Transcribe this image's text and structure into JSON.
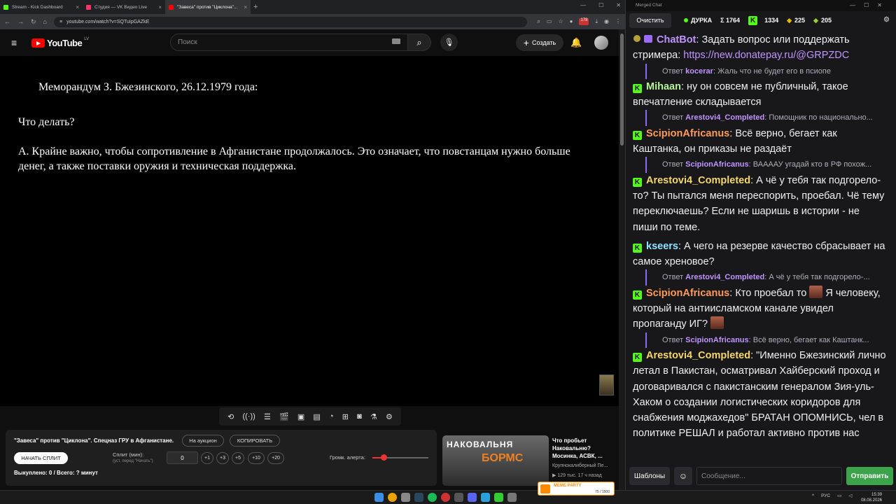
{
  "browser": {
    "tabs": [
      {
        "label": "Stream - Kick Dashboard",
        "color": "#53fc18"
      },
      {
        "label": "Студия — VK Видео Live",
        "color": "#ff3366"
      },
      {
        "label": "\"Завеса\" против \"Циклона\"...",
        "color": "#ff0000"
      }
    ],
    "new_tab": "+",
    "url": "youtube.com/watch?v=SQTuIpGAZkE",
    "ext_badge": "178"
  },
  "youtube": {
    "logo_text": "YouTube",
    "logo_country": "LV",
    "search_placeholder": "Поиск",
    "create_label": "Создать"
  },
  "video": {
    "memo_heading": "Меморандум З. Бжезинского, 26.12.1979 года:",
    "question": "Что делать?",
    "answer": "А. Крайне важно, чтобы сопротивление в Афганистане продолжалось. Это означает, что повстанцам нужно больше денег, а также поставки оружия и техническая поддержка."
  },
  "auction_panel": {
    "title": "\"Завеса\" против \"Циклона\". Спецназ ГРУ в Афганистане.",
    "auction_button": "На аукцион",
    "copy_button": "КОПИРОВАТЬ",
    "start_split_button": "НАЧАТЬ СПЛИТ",
    "split_label": "Сплит (мин):",
    "split_hint": "(уст. перед \"Начать\")",
    "split_value": "0",
    "increments": [
      "+1",
      "+3",
      "+5",
      "+10",
      "+20"
    ],
    "volume_label": "Громк. алерта:",
    "volume_level": 0.2,
    "sold_text": "Выкуплено: 0 / Всего: ? минут"
  },
  "recommendation": {
    "thumb_text_1": "НАКОВАЛЬНЯ",
    "thumb_text_2": "БОРМС",
    "title": "Что пробьет Наковальню? Мосинка, АСВК, ...",
    "channel": "Крупнокалиберный Пе...",
    "meta": "▶ 129 тыс.  17 ч назад"
  },
  "chat": {
    "window_title": "Merged Chat",
    "clear_button": "Очистить",
    "stream_name": "ДУРКА",
    "total": "Σ 1764",
    "kick_count": "1334",
    "other_count_1": "225",
    "other_count_2": "205",
    "messages": [
      {
        "type": "msg",
        "platform": "bot",
        "user": "ChatBot",
        "color": "#bf94ff",
        "text": "Задать вопрос или поддержать стримера: ",
        "link": "https://new.donatepay.ru/@GRPZDC"
      },
      {
        "type": "reply",
        "prefix": "Ответ",
        "user": "kocerar",
        "text": "Жаль что не будет его в псиопе"
      },
      {
        "type": "msg",
        "platform": "kick",
        "user": "Mihaan",
        "color": "#b6f29a",
        "text": "ну он совсем не публичный, такое впечатление складывается"
      },
      {
        "type": "reply",
        "prefix": "Ответ",
        "user": "Arestovi4_Completed",
        "text": "Помощник по национально..."
      },
      {
        "type": "msg",
        "platform": "kick",
        "user": "ScipionAfricanus",
        "color": "#ff9a5a",
        "text": "Всё верно, бегает как Каштанка, он приказы не раздаёт"
      },
      {
        "type": "reply",
        "prefix": "Ответ",
        "user": "ScipionAfricanus",
        "text": "ВААААУ угадай кто в РФ похож..."
      },
      {
        "type": "msg",
        "platform": "kick",
        "user": "Arestovi4_Completed",
        "color": "#f5d76e",
        "text": "А чё у тебя так подгорело-то? Ты пытался меня переспорить, проебал. Чё тему переключаешь? Если не шаришь в истории - не пиши по теме."
      },
      {
        "type": "msg",
        "platform": "kick",
        "user": "kseers",
        "color": "#8fe3ff",
        "text": "А чего на резерве качество сбрасывает на самое хреновое?"
      },
      {
        "type": "reply",
        "prefix": "Ответ",
        "user": "Arestovi4_Completed",
        "text": "А чё у тебя так подгорело-..."
      },
      {
        "type": "msg",
        "platform": "kick",
        "user": "ScipionAfricanus",
        "color": "#ff9a5a",
        "text_parts": [
          "Кто проебал то ",
          " Я человеку, который на антиисламском канале увидел пропаганду ИГ? "
        ]
      },
      {
        "type": "reply",
        "prefix": "Ответ",
        "user": "ScipionAfricanus",
        "text": "Всё верно, бегает как Каштанк..."
      },
      {
        "type": "msg",
        "platform": "kick",
        "user": "Arestovi4_Completed",
        "color": "#f5d76e",
        "text": "\"Именно Бжезинский лично летал в Пакистан, осматривал Хайберский проход и договаривался с пакистанским генералом Зия-уль-Хаком о создании логистических коридоров для снабжения моджахедов\" БРАТАН ОПОМНИСЬ, чел в политике РЕШАЛ и работал активно против нас"
      }
    ],
    "templates_button": "Шаблоны",
    "message_placeholder": "Сообщение...",
    "send_button": "Отправить"
  },
  "taskbar": {
    "meme_label": "MEME PARTY",
    "meme_count": "75 / 1500",
    "lang": "РУС",
    "time": "15:39",
    "date": "08.08.2026"
  }
}
